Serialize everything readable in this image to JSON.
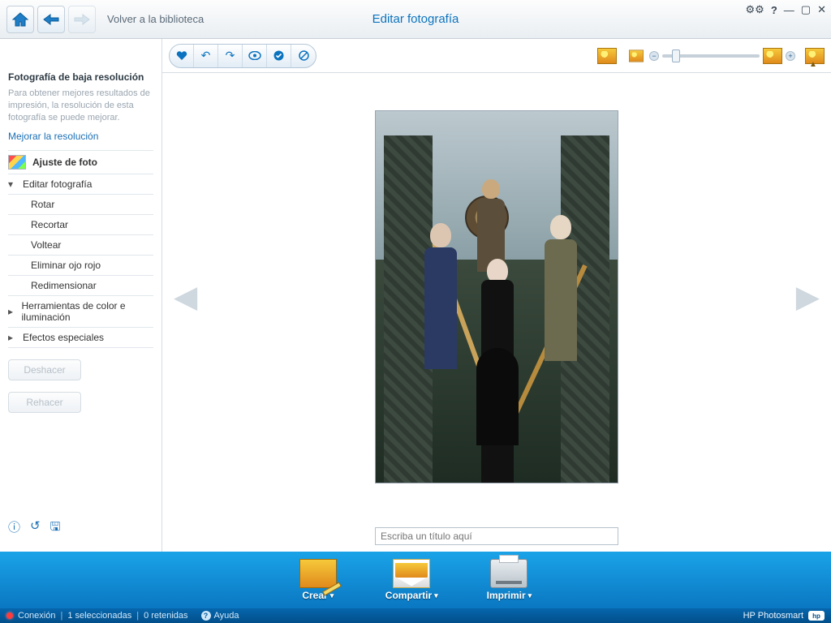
{
  "topbar": {
    "back_label": "Volver a la biblioteca",
    "title": "Editar fotografía"
  },
  "sidebar": {
    "heading": "Fotografía de baja resolución",
    "hint": "Para obtener mejores resultados de impresión, la resolución de esta fotografía se puede mejorar.",
    "improve_link": "Mejorar la resolución",
    "adjust_label": "Ajuste de foto",
    "group_edit": "Editar fotografía",
    "items": [
      "Rotar",
      "Recortar",
      "Voltear",
      "Eliminar ojo rojo",
      "Redimensionar"
    ],
    "group_color": "Herramientas de color e iluminación",
    "group_effects": "Efectos especiales",
    "undo": "Deshacer",
    "redo": "Rehacer"
  },
  "caption": {
    "placeholder": "Escriba un título aquí"
  },
  "dock": {
    "create": "Crear",
    "share": "Compartir",
    "print": "Imprimir"
  },
  "status": {
    "conn": "Conexión",
    "selected": "1 seleccionadas",
    "retained": "0 retenidas",
    "help": "Ayuda",
    "brand": "HP Photosmart"
  }
}
